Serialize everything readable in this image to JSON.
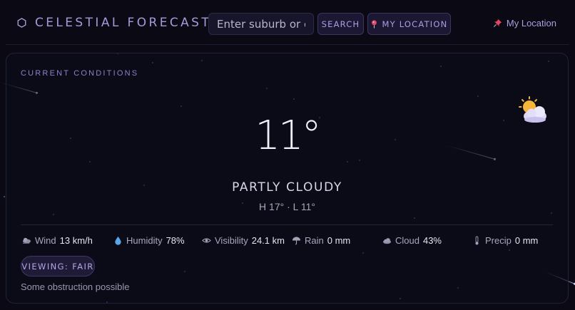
{
  "header": {
    "brand_title": "CELESTIAL FORECAST",
    "search_placeholder": "Enter suburb or cit",
    "search_button": "SEARCH",
    "location_button": "MY LOCATION",
    "my_location_link": "My Location"
  },
  "current": {
    "section_label": "CURRENT CONDITIONS",
    "temperature": "11°",
    "condition": "PARTLY CLOUDY",
    "high_low": "H 17° · L 11°",
    "weather_icon": "partly-cloudy-icon",
    "stats": [
      {
        "label": "Wind",
        "value": "13 km/h",
        "icon": "wind-icon"
      },
      {
        "label": "Humidity",
        "value": "78%",
        "icon": "droplet-icon"
      },
      {
        "label": "Visibility",
        "value": "24.1 km",
        "icon": "eye-icon"
      },
      {
        "label": "Rain",
        "value": "0 mm",
        "icon": "umbrella-icon"
      },
      {
        "label": "Cloud",
        "value": "43%",
        "icon": "cloud-icon"
      },
      {
        "label": "Precip",
        "value": "0 mm",
        "icon": "thermometer-icon"
      }
    ],
    "viewing_badge": "VIEWING: FAIR",
    "viewing_note": "Some obstruction possible"
  },
  "colors": {
    "background": "#0a0914",
    "accent": "#a99fe0",
    "text": "#e6e4f2"
  }
}
